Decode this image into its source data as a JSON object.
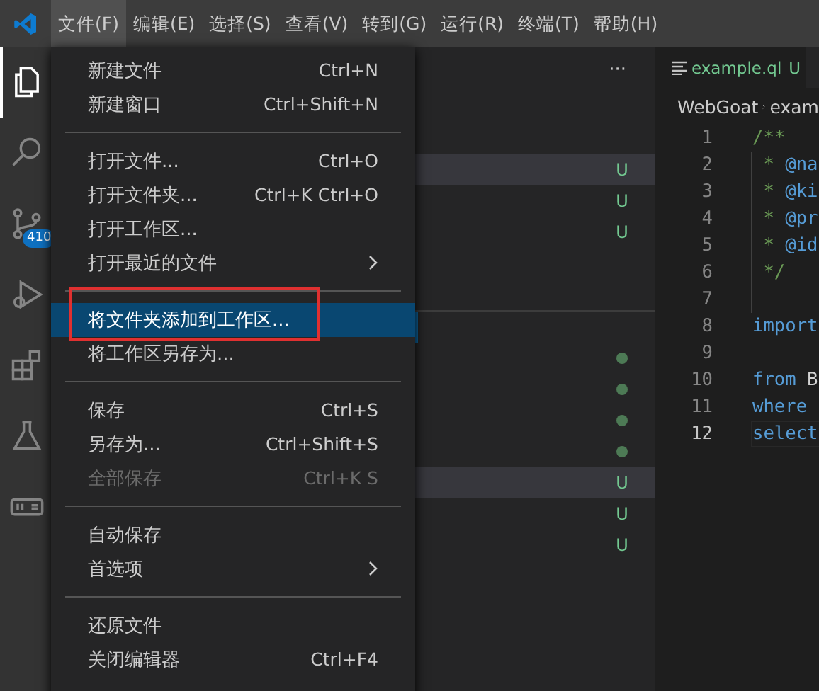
{
  "menu_bar": [
    {
      "label": "文件(F)",
      "selected": true
    },
    {
      "label": "编辑(E)",
      "selected": false
    },
    {
      "label": "选择(S)",
      "selected": false
    },
    {
      "label": "查看(V)",
      "selected": false
    },
    {
      "label": "转到(G)",
      "selected": false
    },
    {
      "label": "运行(R)",
      "selected": false
    },
    {
      "label": "终端(T)",
      "selected": false
    },
    {
      "label": "帮助(H)",
      "selected": false
    }
  ],
  "activity_bar": [
    {
      "kind": "explorer",
      "selected": true
    },
    {
      "kind": "search",
      "selected": false
    },
    {
      "kind": "source-control",
      "selected": false,
      "badge": "410"
    },
    {
      "kind": "debug",
      "selected": false
    },
    {
      "kind": "extensions",
      "selected": false
    },
    {
      "kind": "flask",
      "selected": false
    },
    {
      "kind": "ql",
      "selected": false
    }
  ],
  "file_menu": [
    {
      "kind": "item",
      "label": "新建文件",
      "shortcut": "Ctrl+N",
      "submenu": false,
      "disabled": false,
      "selected": false,
      "annotated": false
    },
    {
      "kind": "item",
      "label": "新建窗口",
      "shortcut": "Ctrl+Shift+N",
      "submenu": false,
      "disabled": false,
      "selected": false,
      "annotated": false
    },
    {
      "kind": "separator"
    },
    {
      "kind": "item",
      "label": "打开文件...",
      "shortcut": "Ctrl+O",
      "submenu": false,
      "disabled": false,
      "selected": false,
      "annotated": false
    },
    {
      "kind": "item",
      "label": "打开文件夹...",
      "shortcut": "Ctrl+K Ctrl+O",
      "submenu": false,
      "disabled": false,
      "selected": false,
      "annotated": false
    },
    {
      "kind": "item",
      "label": "打开工作区...",
      "submenu": false,
      "disabled": false,
      "selected": false,
      "annotated": false
    },
    {
      "kind": "item",
      "label": "打开最近的文件",
      "submenu": true,
      "disabled": false,
      "selected": false,
      "annotated": false
    },
    {
      "kind": "separator"
    },
    {
      "kind": "item",
      "label": "将文件夹添加到工作区...",
      "submenu": false,
      "disabled": false,
      "selected": true,
      "annotated": true
    },
    {
      "kind": "item",
      "label": "将工作区另存为...",
      "submenu": false,
      "disabled": false,
      "selected": false,
      "annotated": false
    },
    {
      "kind": "separator"
    },
    {
      "kind": "item",
      "label": "保存",
      "shortcut": "Ctrl+S",
      "submenu": false,
      "disabled": false,
      "selected": false,
      "annotated": false
    },
    {
      "kind": "item",
      "label": "另存为...",
      "shortcut": "Ctrl+Shift+S",
      "submenu": false,
      "disabled": false,
      "selected": false,
      "annotated": false
    },
    {
      "kind": "item",
      "label": "全部保存",
      "shortcut": "Ctrl+K S",
      "submenu": false,
      "disabled": true,
      "selected": false,
      "annotated": false
    },
    {
      "kind": "separator"
    },
    {
      "kind": "item",
      "label": "自动保存",
      "submenu": false,
      "disabled": false,
      "selected": false,
      "annotated": false
    },
    {
      "kind": "item",
      "label": "首选项",
      "submenu": true,
      "disabled": false,
      "selected": false,
      "annotated": false
    },
    {
      "kind": "separator"
    },
    {
      "kind": "item",
      "label": "还原文件",
      "submenu": false,
      "disabled": false,
      "selected": false,
      "annotated": false
    },
    {
      "kind": "item",
      "label": "关闭编辑器",
      "shortcut": "Ctrl+F4",
      "submenu": false,
      "disabled": false,
      "selected": false,
      "annotated": false
    }
  ],
  "sidebar": {
    "more": "···",
    "sections": [
      {
        "focused": false,
        "rows": [
          {
            "kind": "letter",
            "status": "U",
            "selected": true
          },
          {
            "kind": "letter",
            "status": "U",
            "selected": false
          },
          {
            "kind": "letter",
            "status": "U",
            "selected": false
          }
        ]
      },
      {
        "focused": true,
        "rows": [
          {
            "kind": "empty",
            "selected": false
          },
          {
            "kind": "dot",
            "selected": false
          },
          {
            "kind": "dot",
            "selected": false
          },
          {
            "kind": "dot",
            "selected": false
          },
          {
            "kind": "dot",
            "selected": false
          },
          {
            "kind": "letter",
            "status": "U",
            "selected": true
          },
          {
            "kind": "letter",
            "status": "U",
            "selected": false
          },
          {
            "kind": "letter",
            "status": "U",
            "selected": false
          }
        ]
      }
    ]
  },
  "editor": {
    "tab": {
      "label": "example.ql",
      "status": "U"
    },
    "breadcrumb": [
      "WebGoat",
      "exam"
    ],
    "lines": [
      {
        "number": "1",
        "current": false,
        "guide": false,
        "tokens": [
          {
            "kind": "comment",
            "text": "/**"
          }
        ]
      },
      {
        "number": "2",
        "current": false,
        "guide": true,
        "tokens": [
          {
            "kind": "comment",
            "text": " * "
          },
          {
            "kind": "tag",
            "text": "@na"
          }
        ]
      },
      {
        "number": "3",
        "current": false,
        "guide": true,
        "tokens": [
          {
            "kind": "comment",
            "text": " * "
          },
          {
            "kind": "tag",
            "text": "@ki"
          }
        ]
      },
      {
        "number": "4",
        "current": false,
        "guide": true,
        "tokens": [
          {
            "kind": "comment",
            "text": " * "
          },
          {
            "kind": "tag",
            "text": "@pr"
          }
        ]
      },
      {
        "number": "5",
        "current": false,
        "guide": true,
        "tokens": [
          {
            "kind": "comment",
            "text": " * "
          },
          {
            "kind": "tag",
            "text": "@id"
          }
        ]
      },
      {
        "number": "6",
        "current": false,
        "guide": true,
        "tokens": [
          {
            "kind": "comment",
            "text": " */"
          }
        ]
      },
      {
        "number": "7",
        "current": false,
        "guide": true
      },
      {
        "number": "8",
        "current": false,
        "guide": false,
        "tokens": [
          {
            "kind": "keyword",
            "text": "import"
          }
        ]
      },
      {
        "number": "9",
        "current": false,
        "guide": false
      },
      {
        "number": "10",
        "current": false,
        "guide": false,
        "tokens": [
          {
            "kind": "keyword",
            "text": "from"
          },
          {
            "kind": "plain",
            "text": " B"
          }
        ]
      },
      {
        "number": "11",
        "current": false,
        "guide": false,
        "tokens": [
          {
            "kind": "keyword",
            "text": "where"
          }
        ]
      },
      {
        "number": "12",
        "current": true,
        "guide": false,
        "tokens": [
          {
            "kind": "keyword",
            "text": "select"
          }
        ]
      }
    ]
  }
}
